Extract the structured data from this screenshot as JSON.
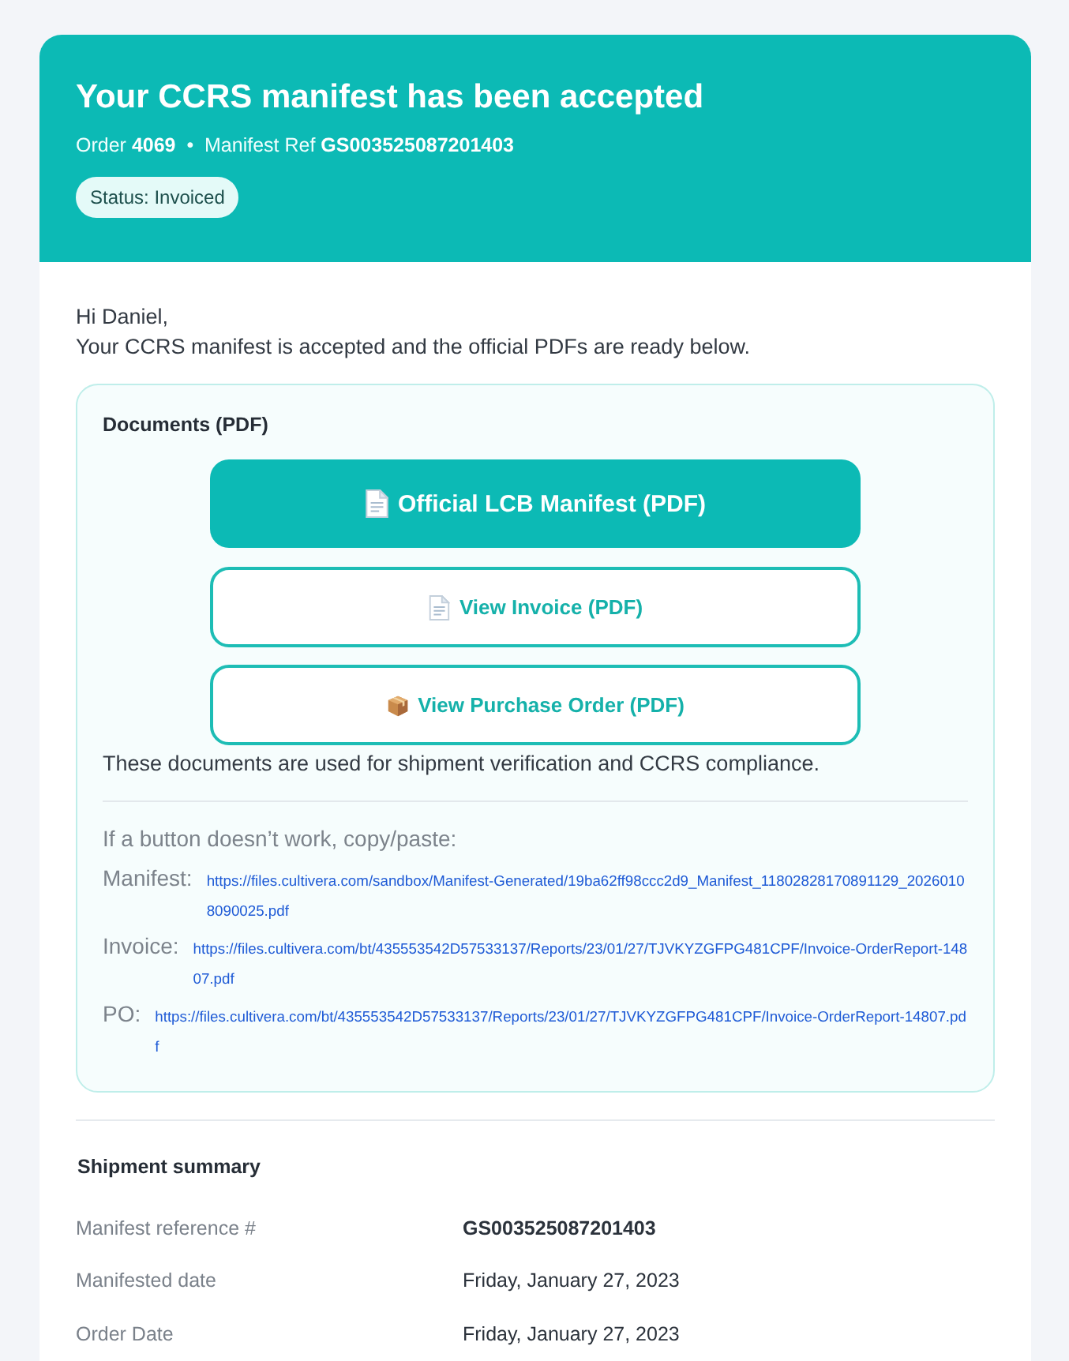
{
  "header": {
    "title": "Your CCRS manifest has been accepted",
    "subtitle": "Order **4069**  •  Manifest Ref **GS003525087201403**",
    "status": "Status: Invoiced"
  },
  "greeting": "Hi Daniel,",
  "intro": "Your CCRS manifest is accepted and the official PDFs are ready below.",
  "documents": {
    "title": "Documents (PDF)",
    "buttons": [
      {
        "label": "Official LCB Manifest (PDF)",
        "kind": "primary"
      },
      {
        "label": "View Invoice (PDF)",
        "kind": "outline"
      },
      {
        "label": "View Purchase Order (PDF)",
        "kind": "outline"
      }
    ],
    "note": "These documents are used for shipment verification and CCRS compliance.",
    "fallback_hint": "If a button doesn’t work, copy/paste:",
    "links": [
      {
        "label": "Manifest:",
        "url": "https://files.cultivera.com/sandbox/Manifest-Generated/19ba62ff98ccc2d9_Manifest_11802828170891129_20260108090025.pdf"
      },
      {
        "label": "Invoice:",
        "url": "https://files.cultivera.com/bt/435553542D57533137/Reports/23/01/27/TJVKYZGFPG481CPF/Invoice-OrderReport-14807.pdf"
      },
      {
        "label": "PO:",
        "url": "https://files.cultivera.com/bt/435553542D57533137/Reports/23/01/27/TJVKYZGFPG481CPF/Invoice-OrderReport-14807.pdf"
      }
    ]
  },
  "summary": {
    "title": "Shipment summary",
    "rows": [
      {
        "label": "Manifest reference #",
        "value": "GS003525087201403",
        "kind": "strong"
      },
      {
        "label": "Manifested date",
        "value": "Friday, January 27, 2023",
        "kind": "plain"
      },
      {
        "label": "Order Date",
        "value": "Friday, January 27, 2023",
        "kind": "plain"
      }
    ]
  }
}
